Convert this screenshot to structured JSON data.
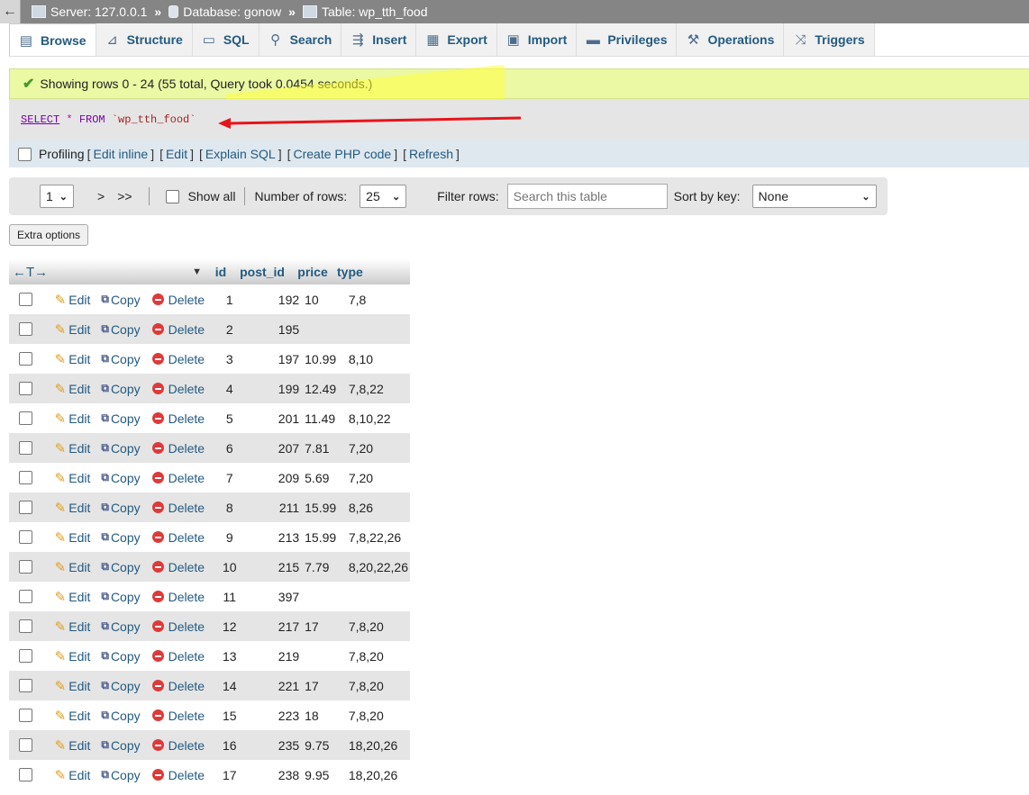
{
  "breadcrumb": {
    "back_glyph": "←",
    "server": "Server: 127.0.0.1",
    "database": "Database: gonow",
    "table": "Table: wp_tth_food",
    "separator": "»"
  },
  "tabs": [
    {
      "label": "Browse",
      "icon": "browse-icon",
      "glyph": "▤"
    },
    {
      "label": "Structure",
      "icon": "structure-icon",
      "glyph": "⊿"
    },
    {
      "label": "SQL",
      "icon": "sql-icon",
      "glyph": "▭"
    },
    {
      "label": "Search",
      "icon": "search-icon",
      "glyph": "⚲"
    },
    {
      "label": "Insert",
      "icon": "insert-icon",
      "glyph": "⇶"
    },
    {
      "label": "Export",
      "icon": "export-icon",
      "glyph": "▦"
    },
    {
      "label": "Import",
      "icon": "import-icon",
      "glyph": "▣"
    },
    {
      "label": "Privileges",
      "icon": "privileges-icon",
      "glyph": "▬"
    },
    {
      "label": "Operations",
      "icon": "wrench-icon",
      "glyph": "⚒"
    },
    {
      "label": "Triggers",
      "icon": "triggers-icon",
      "glyph": "⤨"
    }
  ],
  "message": {
    "check_glyph": "✔",
    "text": "Showing rows 0 - 24 (55 total, Query took 0.0454 seconds.)"
  },
  "sql": {
    "select": "SELECT",
    "star": "*",
    "from": "FROM",
    "table": "`wp_tth_food`"
  },
  "profiling": {
    "label": "Profiling",
    "edit_inline": "Edit inline",
    "edit": "Edit",
    "explain": "Explain SQL",
    "create_php": "Create PHP code",
    "refresh": "Refresh",
    "open_bracket": "[",
    "close_bracket": "]"
  },
  "nav": {
    "page": "1",
    "next": ">",
    "last": ">>",
    "show_all": "Show all",
    "num_rows_label": "Number of rows:",
    "num_rows": "25",
    "filter_label": "Filter rows:",
    "filter_placeholder": "Search this table",
    "sort_label": "Sort by key:",
    "sort_value": "None",
    "chevron": "⌄"
  },
  "extra_options": "Extra options",
  "table": {
    "resize_glyph": "←T→",
    "sort_glyph": "▼",
    "columns": [
      "id",
      "post_id",
      "price",
      "type"
    ],
    "actions": {
      "edit": "Edit",
      "copy": "Copy",
      "delete": "Delete",
      "pencil_glyph": "✎",
      "copy_glyph": "⧉"
    },
    "rows": [
      {
        "id": "1",
        "post_id": "192",
        "price": "10",
        "type": "7,8"
      },
      {
        "id": "2",
        "post_id": "195",
        "price": "",
        "type": ""
      },
      {
        "id": "3",
        "post_id": "197",
        "price": "10.99",
        "type": "8,10"
      },
      {
        "id": "4",
        "post_id": "199",
        "price": "12.49",
        "type": "7,8,22"
      },
      {
        "id": "5",
        "post_id": "201",
        "price": "11.49",
        "type": "8,10,22"
      },
      {
        "id": "6",
        "post_id": "207",
        "price": "7.81",
        "type": "7,20"
      },
      {
        "id": "7",
        "post_id": "209",
        "price": "5.69",
        "type": "7,20"
      },
      {
        "id": "8",
        "post_id": "211",
        "price": "15.99",
        "type": "8,26"
      },
      {
        "id": "9",
        "post_id": "213",
        "price": "15.99",
        "type": "7,8,22,26"
      },
      {
        "id": "10",
        "post_id": "215",
        "price": "7.79",
        "type": "8,20,22,26"
      },
      {
        "id": "11",
        "post_id": "397",
        "price": "",
        "type": ""
      },
      {
        "id": "12",
        "post_id": "217",
        "price": "17",
        "type": "7,8,20"
      },
      {
        "id": "13",
        "post_id": "219",
        "price": "",
        "type": "7,8,20"
      },
      {
        "id": "14",
        "post_id": "221",
        "price": "17",
        "type": "7,8,20"
      },
      {
        "id": "15",
        "post_id": "223",
        "price": "18",
        "type": "7,8,20"
      },
      {
        "id": "16",
        "post_id": "235",
        "price": "9.75",
        "type": "18,20,26"
      },
      {
        "id": "17",
        "post_id": "238",
        "price": "9.95",
        "type": "18,20,26"
      }
    ]
  },
  "colors": {
    "link": "#235a81",
    "success_bg": "#ebf8a4",
    "annotation_arrow": "#e8141a",
    "annotation_highlight": "#ffff3c"
  }
}
